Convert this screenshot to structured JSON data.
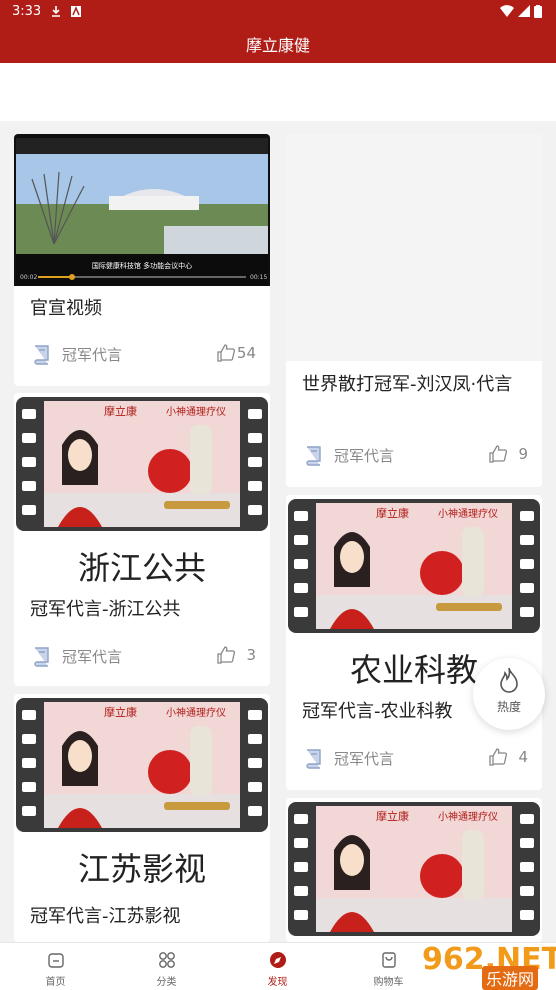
{
  "status": {
    "time": "3:33"
  },
  "app": {
    "title": "摩立康健"
  },
  "cards": [
    {
      "title": "官宣视频",
      "category": "冠军代言",
      "likes": "54"
    },
    {
      "title": "世界散打冠军-刘汉凤·代言",
      "category": "冠军代言",
      "likes": "9"
    },
    {
      "title": "冠军代言-浙江公共",
      "category": "冠军代言",
      "likes": "3",
      "thumb_text": "浙江公共"
    },
    {
      "title": "冠军代言-农业科教",
      "category": "冠军代言",
      "likes": "4",
      "thumb_text": "农业科教"
    },
    {
      "title": "冠军代言-江苏影视",
      "thumb_text": "江苏影视"
    },
    {
      "title": ""
    }
  ],
  "video": {
    "caption": "国际健康科技馆 多功能会议中心",
    "time_left": "00:02",
    "time_right": "00:15"
  },
  "film": {
    "brand": "摩立康",
    "product": "小神通理疗仪"
  },
  "fab": {
    "label": "热度",
    "icon": "fire-icon"
  },
  "tabs": [
    {
      "label": "首页",
      "icon": "home-icon"
    },
    {
      "label": "分类",
      "icon": "category-icon"
    },
    {
      "label": "发现",
      "icon": "compass-icon",
      "active": true
    },
    {
      "label": "购物车",
      "icon": "cart-icon"
    }
  ],
  "watermark": {
    "num": "962.NET",
    "sub": "乐游网"
  },
  "colors": {
    "brand": "#b01c16",
    "muted": "#888888"
  }
}
